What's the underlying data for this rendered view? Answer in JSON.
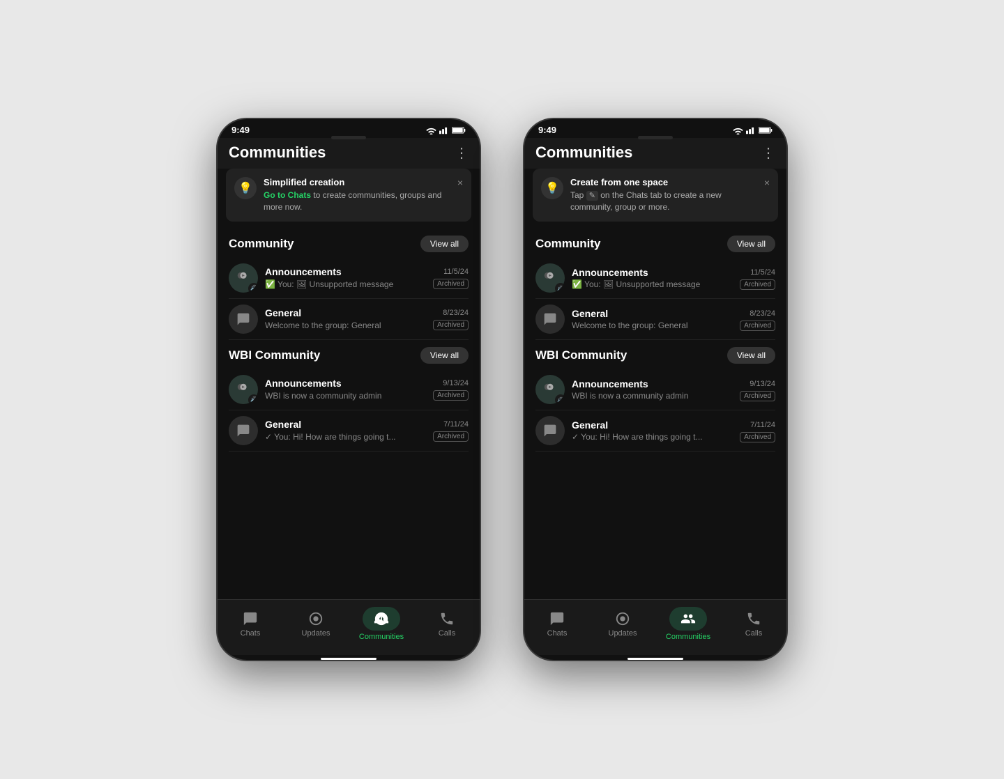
{
  "page": {
    "bg_color": "#e8e8e8"
  },
  "phones": [
    {
      "id": "phone-left",
      "status_time": "9:49",
      "header_title": "Communities",
      "banner": {
        "icon": "💡",
        "title": "Simplified creation",
        "text_before_link": "",
        "link_text": "Go to Chats",
        "text_after_link": " to create communities, groups and more now.",
        "close_label": "×"
      },
      "sections": [
        {
          "id": "community",
          "title": "Community",
          "view_all_label": "View all",
          "chats": [
            {
              "id": "announcements-1",
              "name": "Announcements",
              "time": "11/5/24",
              "msg": "✅ You: 🖼 Unsupported message",
              "archived": true,
              "avatar_type": "announcement"
            },
            {
              "id": "general-1",
              "name": "General",
              "time": "8/23/24",
              "msg": "Welcome to the group: General",
              "archived": true,
              "avatar_type": "general"
            }
          ]
        },
        {
          "id": "wbi-community",
          "title": "WBI Community",
          "view_all_label": "View all",
          "chats": [
            {
              "id": "announcements-2",
              "name": "Announcements",
              "time": "9/13/24",
              "msg": "WBI is now a community admin",
              "archived": true,
              "avatar_type": "announcement"
            },
            {
              "id": "general-2",
              "name": "General",
              "time": "7/11/24",
              "msg": "✓ You: Hi! How are things going t...",
              "archived": true,
              "avatar_type": "general"
            }
          ]
        }
      ],
      "nav": {
        "items": [
          {
            "id": "chats",
            "label": "Chats",
            "active": false,
            "icon": "chats-icon"
          },
          {
            "id": "updates",
            "label": "Updates",
            "active": false,
            "icon": "updates-icon"
          },
          {
            "id": "communities",
            "label": "Communities",
            "active": true,
            "icon": "communities-icon"
          },
          {
            "id": "calls",
            "label": "Calls",
            "active": false,
            "icon": "calls-icon"
          }
        ]
      }
    },
    {
      "id": "phone-right",
      "status_time": "9:49",
      "header_title": "Communities",
      "banner": {
        "icon": "💡",
        "title": "Create from one space",
        "text_before_link": "Tap ",
        "link_text": "",
        "text_after_link": " on the Chats tab to create a new community, group or more.",
        "close_label": "×"
      },
      "sections": [
        {
          "id": "community",
          "title": "Community",
          "view_all_label": "View all",
          "chats": [
            {
              "id": "announcements-1",
              "name": "Announcements",
              "time": "11/5/24",
              "msg": "✅ You: 🖼 Unsupported message",
              "archived": true,
              "avatar_type": "announcement"
            },
            {
              "id": "general-1",
              "name": "General",
              "time": "8/23/24",
              "msg": "Welcome to the group: General",
              "archived": true,
              "avatar_type": "general"
            }
          ]
        },
        {
          "id": "wbi-community",
          "title": "WBI Community",
          "view_all_label": "View all",
          "chats": [
            {
              "id": "announcements-2",
              "name": "Announcements",
              "time": "9/13/24",
              "msg": "WBI is now a community admin",
              "archived": true,
              "avatar_type": "announcement"
            },
            {
              "id": "general-2",
              "name": "General",
              "time": "7/11/24",
              "msg": "✓ You: Hi! How are things going t...",
              "archived": true,
              "avatar_type": "general"
            }
          ]
        }
      ],
      "nav": {
        "items": [
          {
            "id": "chats",
            "label": "Chats",
            "active": false,
            "icon": "chats-icon"
          },
          {
            "id": "updates",
            "label": "Updates",
            "active": false,
            "icon": "updates-icon"
          },
          {
            "id": "communities",
            "label": "Communities",
            "active": true,
            "icon": "communities-icon"
          },
          {
            "id": "calls",
            "label": "Calls",
            "active": false,
            "icon": "calls-icon"
          }
        ]
      }
    }
  ],
  "labels": {
    "archived": "Archived",
    "view_all": "View all"
  }
}
